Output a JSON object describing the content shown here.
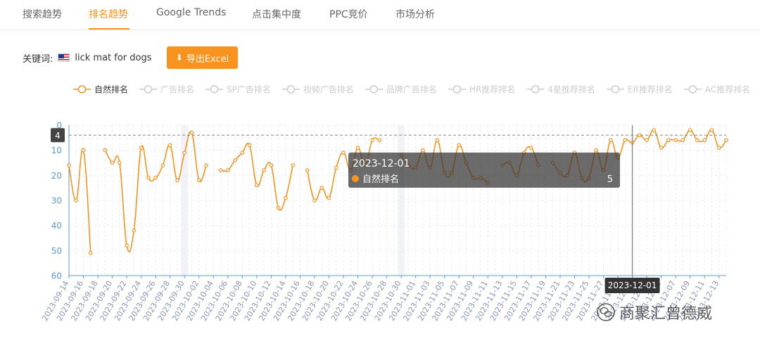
{
  "tabs": [
    {
      "label": "搜索趋势"
    },
    {
      "label": "排名趋势"
    },
    {
      "label": "Google Trends"
    },
    {
      "label": "点击集中度"
    },
    {
      "label": "PPC竞价"
    },
    {
      "label": "市场分析"
    }
  ],
  "active_tab": 1,
  "keyword": {
    "label": "关键词:",
    "value": "lick mat for dogs",
    "flag": "us-flag-icon"
  },
  "export_button": {
    "label": "导出Excel",
    "icon": "download-icon"
  },
  "watermark": {
    "text": "商聚汇曾德威",
    "icon": "wechat-logo-icon"
  },
  "colors": {
    "accent": "#f7931e",
    "inactive": "#cccccc",
    "axis": "#5b9bd5"
  },
  "chart_data": {
    "type": "line",
    "legend_position": "top",
    "legend": [
      "自然排名",
      "广告排名",
      "SP广告排名",
      "视频广告排名",
      "品牌广告排名",
      "HR推荐排名",
      "4星推荐排名",
      "ER推荐排名",
      "AC推荐排名"
    ],
    "active_series": 0,
    "y_axis": {
      "inverse": true,
      "min": 0,
      "max": 60,
      "ticks": [
        0,
        10,
        20,
        30,
        40,
        50,
        60
      ],
      "grid": true
    },
    "x_axis": {
      "start": "2023-09-14",
      "end": "2023-12-14",
      "label_every_days": 2,
      "grid": true
    },
    "x_tick_labels": [
      "2023-09-14",
      "2023-09-16",
      "2023-09-18",
      "2023-09-20",
      "2023-09-22",
      "2023-09-24",
      "2023-09-26",
      "2023-09-28",
      "2023-09-30",
      "2023-10-02",
      "2023-10-04",
      "2023-10-06",
      "2023-10-08",
      "2023-10-10",
      "2023-10-12",
      "2023-10-14",
      "2023-10-16",
      "2023-10-18",
      "2023-10-20",
      "2023-10-22",
      "2023-10-24",
      "2023-10-26",
      "2023-10-28",
      "2023-10-30",
      "2023-11-01",
      "2023-11-03",
      "2023-11-05",
      "2023-11-07",
      "2023-11-09",
      "2023-11-11",
      "2023-11-13",
      "2023-11-15",
      "2023-11-17",
      "2023-11-19",
      "2023-11-21",
      "2023-11-23",
      "2023-11-25",
      "2023-11-27",
      "2023-11-29",
      "2023-12-01",
      "2023-12-03",
      "2023-12-05",
      "2023-12-07",
      "2023-12-09",
      "2023-12-11",
      "2023-12-13"
    ],
    "highlight_dates": [
      "2023-09-30",
      "2023-10-30"
    ],
    "series": [
      {
        "name": "自然排名",
        "segments": [
          [
            [
              "2023-09-14",
              16
            ],
            [
              "2023-09-15",
              30
            ],
            [
              "2023-09-16",
              10
            ],
            [
              "2023-09-17",
              51
            ]
          ],
          [
            [
              "2023-09-19",
              10
            ],
            [
              "2023-09-20",
              15
            ],
            [
              "2023-09-21",
              15
            ],
            [
              "2023-09-22",
              48
            ],
            [
              "2023-09-23",
              42
            ],
            [
              "2023-09-24",
              9
            ],
            [
              "2023-09-25",
              21
            ],
            [
              "2023-09-26",
              21
            ],
            [
              "2023-09-27",
              16
            ],
            [
              "2023-09-28",
              8
            ],
            [
              "2023-09-29",
              22
            ],
            [
              "2023-09-30",
              11
            ],
            [
              "2023-10-01",
              3
            ],
            [
              "2023-10-02",
              22
            ],
            [
              "2023-10-03",
              16
            ]
          ],
          [
            [
              "2023-10-05",
              18
            ],
            [
              "2023-10-06",
              18
            ],
            [
              "2023-10-07",
              14
            ],
            [
              "2023-10-08",
              11
            ],
            [
              "2023-10-09",
              8
            ],
            [
              "2023-10-10",
              24
            ],
            [
              "2023-10-11",
              18
            ],
            [
              "2023-10-12",
              16
            ],
            [
              "2023-10-13",
              33
            ],
            [
              "2023-10-14",
              29
            ],
            [
              "2023-10-15",
              16
            ]
          ],
          [
            [
              "2023-10-17",
              18
            ],
            [
              "2023-10-18",
              30
            ],
            [
              "2023-10-19",
              25
            ],
            [
              "2023-10-20",
              29
            ],
            [
              "2023-10-21",
              17
            ],
            [
              "2023-10-22",
              11
            ],
            [
              "2023-10-23",
              18
            ],
            [
              "2023-10-24",
              9
            ],
            [
              "2023-10-25",
              16
            ],
            [
              "2023-10-26",
              6
            ],
            [
              "2023-10-27",
              6
            ]
          ],
          [
            [
              "2023-10-30",
              12
            ],
            [
              "2023-10-31",
              16
            ],
            [
              "2023-11-01",
              17
            ],
            [
              "2023-11-02",
              10
            ],
            [
              "2023-11-03",
              17
            ],
            [
              "2023-11-04",
              6
            ],
            [
              "2023-11-05",
              19
            ],
            [
              "2023-11-06",
              19
            ],
            [
              "2023-11-07",
              8
            ],
            [
              "2023-11-08",
              15
            ],
            [
              "2023-11-09",
              21
            ],
            [
              "2023-11-10",
              21
            ],
            [
              "2023-11-11",
              23
            ]
          ],
          [
            [
              "2023-11-13",
              16
            ],
            [
              "2023-11-14",
              15
            ],
            [
              "2023-11-15",
              20
            ],
            [
              "2023-11-16",
              11
            ],
            [
              "2023-11-17",
              9
            ],
            [
              "2023-11-18",
              16
            ]
          ],
          [
            [
              "2023-11-20",
              15
            ],
            [
              "2023-11-21",
              19
            ],
            [
              "2023-11-22",
              20
            ],
            [
              "2023-11-23",
              11
            ],
            [
              "2023-11-24",
              21
            ],
            [
              "2023-11-25",
              21
            ],
            [
              "2023-11-26",
              10
            ],
            [
              "2023-11-27",
              18
            ],
            [
              "2023-11-28",
              6
            ],
            [
              "2023-11-29",
              13
            ],
            [
              "2023-11-30",
              6
            ],
            [
              "2023-12-01",
              7
            ],
            [
              "2023-12-02",
              4
            ],
            [
              "2023-12-03",
              6
            ],
            [
              "2023-12-04",
              2
            ],
            [
              "2023-12-05",
              9
            ],
            [
              "2023-12-06",
              6
            ],
            [
              "2023-12-07",
              6
            ],
            [
              "2023-12-08",
              6
            ],
            [
              "2023-12-09",
              2
            ],
            [
              "2023-12-10",
              6
            ],
            [
              "2023-12-11",
              6
            ],
            [
              "2023-12-12",
              2
            ],
            [
              "2023-12-13",
              9
            ],
            [
              "2023-12-14",
              6
            ]
          ]
        ]
      }
    ],
    "crosshair": {
      "date": "2023-12-01",
      "y_value": 4,
      "y_label": "4",
      "x_label": "2023-12-01"
    },
    "tooltip": {
      "title": "2023-12-01",
      "series_name": "自然排名",
      "value": "5"
    }
  }
}
